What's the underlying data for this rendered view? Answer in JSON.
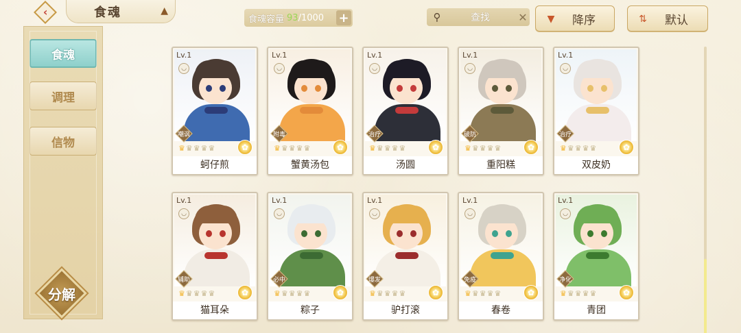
{
  "header": {
    "title": "食魂",
    "capacity_label": "食魂容量",
    "capacity_count": "93",
    "capacity_max": "/1000",
    "search_placeholder": "查找",
    "sort_order_label": "降序",
    "sort_mode_label": "默认"
  },
  "sidebar": {
    "items": [
      {
        "label": "食魂",
        "active": true
      },
      {
        "label": "调理",
        "active": false
      },
      {
        "label": "信物",
        "active": false
      }
    ],
    "decompose_label": "分解"
  },
  "cards": [
    {
      "level": "Lv.1",
      "name": "蚵仔煎",
      "role": "嘲讽",
      "stars": 1,
      "theme": {
        "hair": "#4a3b33",
        "body": "#3f6bb0",
        "bg": "#eef1f6",
        "acc": "#2c3c78"
      }
    },
    {
      "level": "Lv.1",
      "name": "蟹黄汤包",
      "role": "附毒",
      "stars": 1,
      "theme": {
        "hair": "#1e1a1a",
        "body": "#f3a64a",
        "bg": "#f8efe2",
        "acc": "#e38b3a"
      }
    },
    {
      "level": "Lv.1",
      "name": "汤圆",
      "role": "治疗",
      "stars": 1,
      "theme": {
        "hair": "#1d1b26",
        "body": "#2d2f38",
        "bg": "#f7f2ea",
        "acc": "#c43b3b"
      }
    },
    {
      "level": "Lv.1",
      "name": "重阳糕",
      "role": "破防",
      "stars": 1,
      "theme": {
        "hair": "#cfc7bd",
        "body": "#8c7a55",
        "bg": "#f3ede0",
        "acc": "#5d5a3a"
      }
    },
    {
      "level": "Lv.1",
      "name": "双皮奶",
      "role": "治疗",
      "stars": 1,
      "theme": {
        "hair": "#e9e4e0",
        "body": "#f3ecec",
        "bg": "#eef4f8",
        "acc": "#e7c06a"
      }
    },
    {
      "level": "Lv.1",
      "name": "猫耳朵",
      "role": "辅助",
      "stars": 1,
      "theme": {
        "hair": "#8e5f3c",
        "body": "#f1ece4",
        "bg": "#f5ede0",
        "acc": "#b8342e"
      }
    },
    {
      "level": "Lv.1",
      "name": "粽子",
      "role": "必中",
      "stars": 1,
      "theme": {
        "hair": "#e8ecef",
        "body": "#5f8f4a",
        "bg": "#f2f4ee",
        "acc": "#3c6b33"
      }
    },
    {
      "level": "Lv.1",
      "name": "驴打滚",
      "role": "爆发",
      "stars": 1,
      "theme": {
        "hair": "#e6b04e",
        "body": "#f4efe6",
        "bg": "#f8f0df",
        "acc": "#9b2d2d"
      }
    },
    {
      "level": "Lv.1",
      "name": "春卷",
      "role": "免疫",
      "stars": 1,
      "theme": {
        "hair": "#d7d2c6",
        "body": "#f1c65c",
        "bg": "#f6f2e4",
        "acc": "#3fa38f"
      }
    },
    {
      "level": "Lv.1",
      "name": "青团",
      "role": "净化",
      "stars": 1,
      "theme": {
        "hair": "#6fae55",
        "body": "#7fbf69",
        "bg": "#e9f2df",
        "acc": "#3c7b2f"
      }
    }
  ]
}
